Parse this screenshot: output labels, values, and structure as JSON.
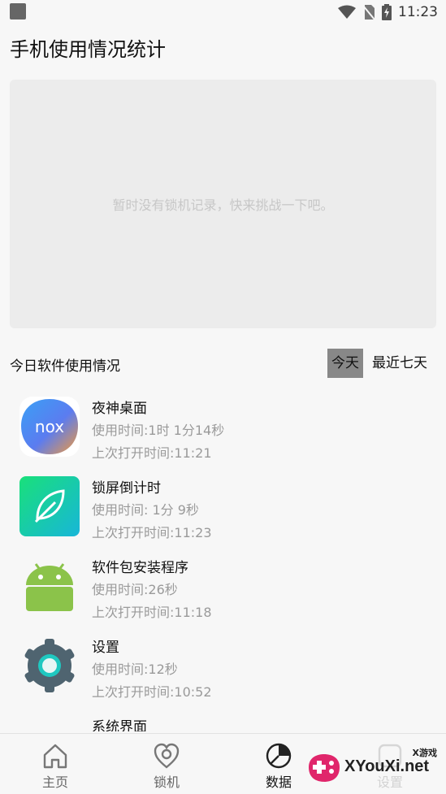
{
  "status_bar": {
    "time": "11:23"
  },
  "header": {
    "title": "手机使用情况统计"
  },
  "chart_panel": {
    "empty_message": "暂时没有锁机记录，快来挑战一下吧。"
  },
  "usage_section": {
    "title": "今日软件使用情况",
    "tabs": [
      {
        "label": "今天",
        "selected": true
      },
      {
        "label": "最近七天",
        "selected": false
      }
    ]
  },
  "apps": [
    {
      "name": "夜神桌面",
      "usage": "使用时间:1时 1分14秒",
      "last_open": "上次打开时间:11:21",
      "icon": "nox-launcher-icon"
    },
    {
      "name": "锁屏倒计时",
      "usage": "使用时间: 1分 9秒",
      "last_open": "上次打开时间:11:23",
      "icon": "leaf-app-icon"
    },
    {
      "name": "软件包安装程序",
      "usage": "使用时间:26秒",
      "last_open": "上次打开时间:11:18",
      "icon": "android-icon"
    },
    {
      "name": "设置",
      "usage": "使用时间:12秒",
      "last_open": "上次打开时间:10:52",
      "icon": "settings-gear-icon"
    },
    {
      "name": "系统界面",
      "usage": "",
      "last_open": "",
      "icon": ""
    }
  ],
  "bottom_nav": {
    "items": [
      {
        "label": "主页",
        "icon": "home-icon",
        "active": false
      },
      {
        "label": "锁机",
        "icon": "heart-lock-icon",
        "active": false
      },
      {
        "label": "数据",
        "icon": "pie-chart-icon",
        "active": true
      },
      {
        "label": "设置",
        "icon": "settings-icon",
        "active": false
      }
    ]
  },
  "watermark": {
    "text": "XYouXi.net",
    "sub": "X游戏"
  },
  "colors": {
    "active_tab_bg": "#888888",
    "panel_bg": "#ececec",
    "muted_text": "#9a9a9a"
  }
}
